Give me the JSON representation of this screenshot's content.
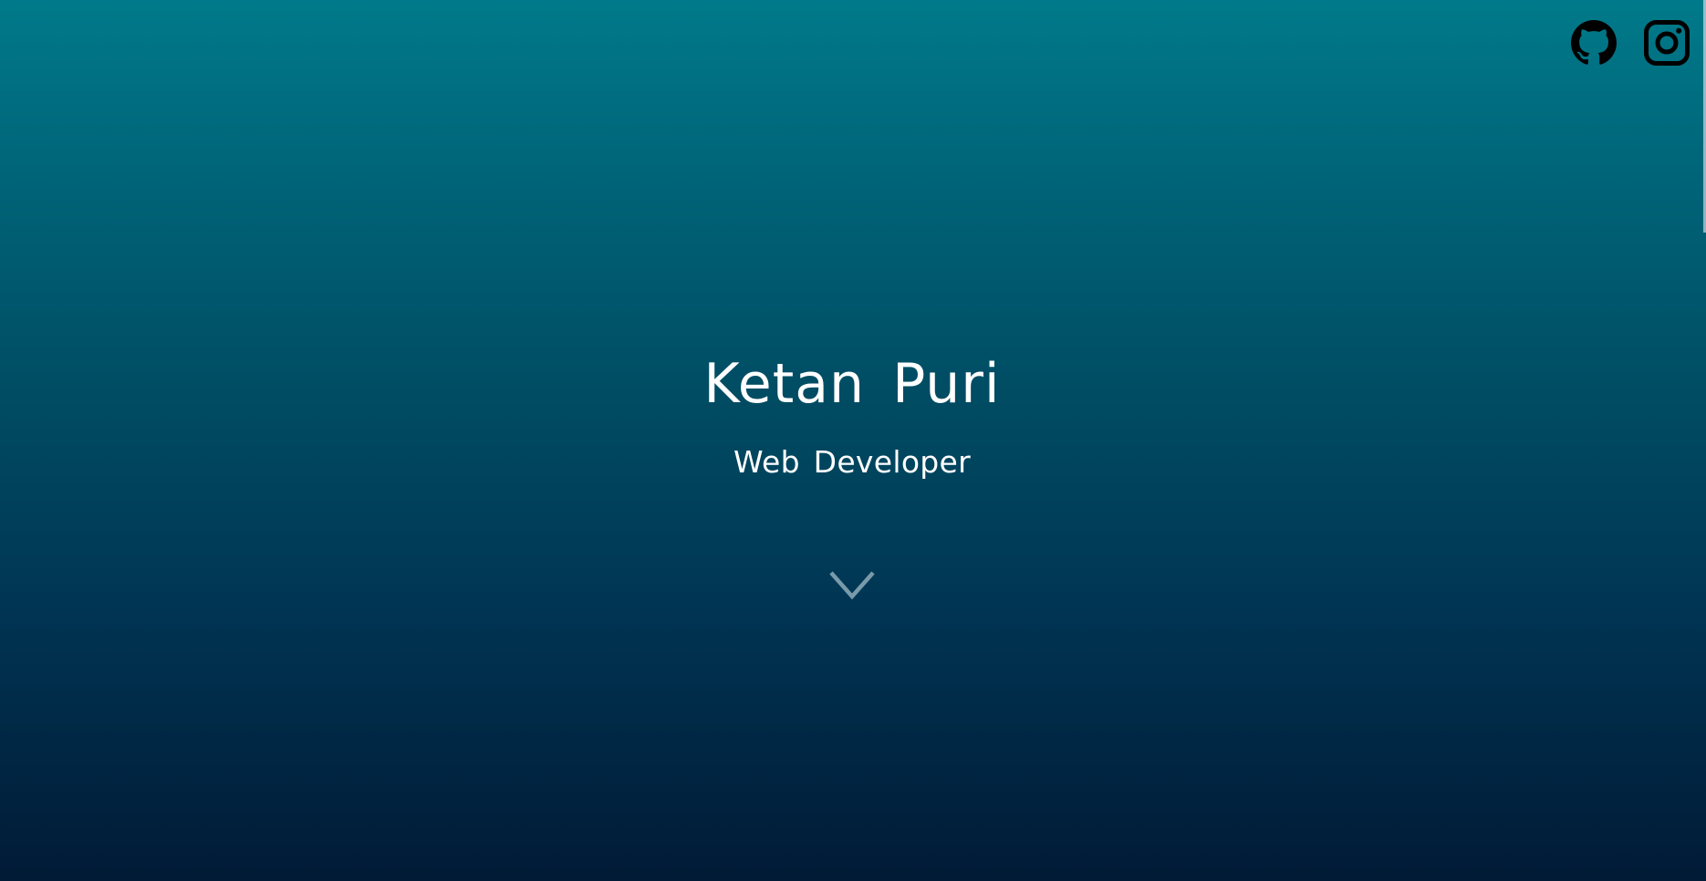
{
  "hero": {
    "name": "Ketan Puri",
    "role": "Web Developer",
    "background_top": "#007a8a",
    "background_bottom": "#011a36"
  },
  "social": {
    "items": [
      {
        "icon": "github-icon"
      },
      {
        "icon": "instagram-icon"
      }
    ]
  },
  "scroll_cue": {
    "icon": "chevron-down-icon"
  }
}
